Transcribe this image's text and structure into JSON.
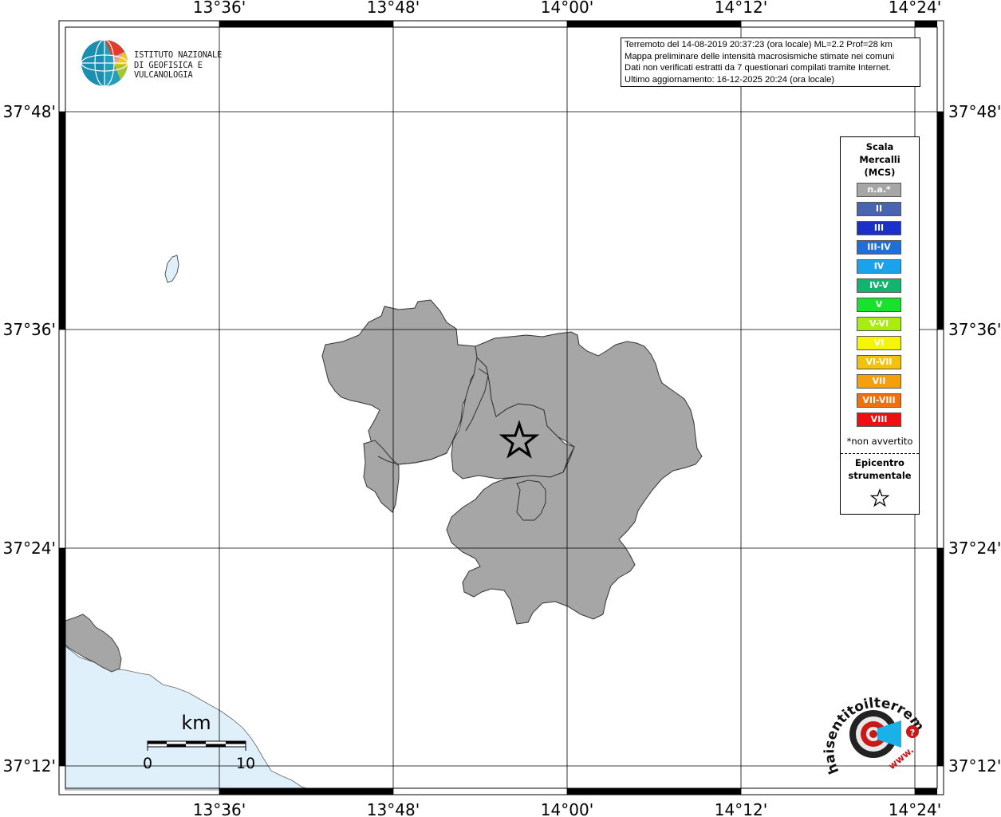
{
  "map": {
    "top_ticks": [
      "13°36'",
      "13°48'",
      "14°00'",
      "14°12'",
      "14°24'"
    ],
    "bottom_ticks": [
      "13°36'",
      "13°48'",
      "14°00'",
      "14°12'",
      "14°24'"
    ],
    "left_ticks": [
      "37°48'",
      "37°36'",
      "37°24'",
      "37°12'"
    ],
    "right_ticks": [
      "37°48'",
      "37°36'",
      "37°24'",
      "37°12'"
    ],
    "sea_color": "#dff0fb",
    "affected_area_color": "#a6a6a6",
    "land_color": "#a0a0a0"
  },
  "institute": {
    "line1": "ISTITUTO NAZIONALE",
    "line2": "DI GEOFISICA E VULCANOLOGIA"
  },
  "info": {
    "line1": "Terremoto del 14-08-2019 20:37:23 (ora locale) ML=2.2 Prof=28 km",
    "line2": "Mappa preliminare delle intensità macrosismiche stimate nei comuni",
    "line3": "Dati non verificati estratti da 7 questionari compilati tramite Internet.",
    "line4": "Ultimo aggiornamento: 16-12-2025 20:24 (ora locale)"
  },
  "legend": {
    "title_line1": "Scala",
    "title_line2": "Mercalli",
    "title_line3": "(MCS)",
    "items": [
      {
        "label": "n.a.*",
        "color": "#a6a6a6"
      },
      {
        "label": "II",
        "color": "#4a64b4"
      },
      {
        "label": "III",
        "color": "#1a30c8"
      },
      {
        "label": "III-IV",
        "color": "#1f6fd6"
      },
      {
        "label": "IV",
        "color": "#1aa3ea"
      },
      {
        "label": "IV-V",
        "color": "#12b46e"
      },
      {
        "label": "V",
        "color": "#18e22a"
      },
      {
        "label": "V-VI",
        "color": "#a8ec10"
      },
      {
        "label": "VI",
        "color": "#f5f50a"
      },
      {
        "label": "VI-VII",
        "color": "#f5c20a"
      },
      {
        "label": "VII",
        "color": "#f5a00a"
      },
      {
        "label": "VII-VIII",
        "color": "#f07010"
      },
      {
        "label": "VIII",
        "color": "#ee1010"
      }
    ],
    "note": "*non avvertito",
    "epicenter_line1": "Epicentro",
    "epicenter_line2": "strumentale"
  },
  "scale_bar": {
    "unit": "km",
    "start": "0",
    "end": "10"
  },
  "brand": {
    "text": "haisentitoilterremoto.it",
    "www": "www."
  }
}
